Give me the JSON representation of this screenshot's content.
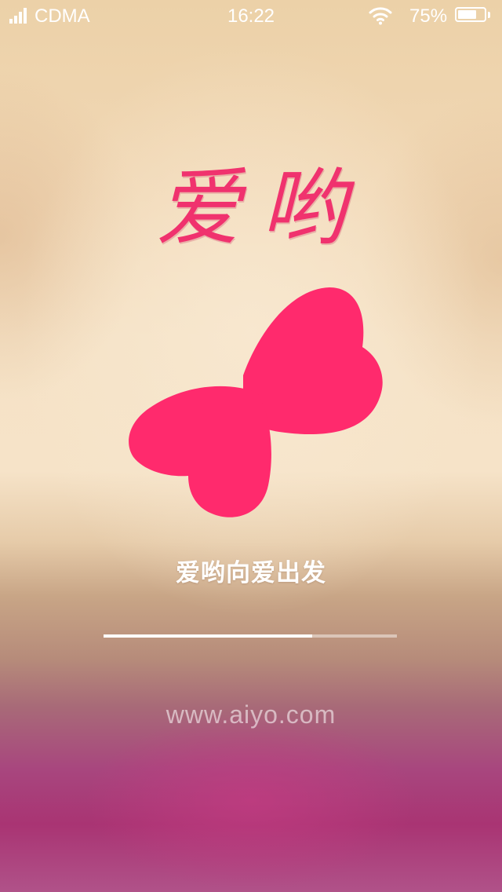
{
  "status_bar": {
    "carrier": "CDMA",
    "time": "16:22",
    "battery_percent_label": "75%",
    "battery_level": 0.75,
    "icons": [
      "signal-icon",
      "wifi-icon",
      "battery-icon"
    ]
  },
  "splash": {
    "brand_title": "爱哟",
    "tagline": "爱哟向爱出发",
    "progress": 0.71,
    "website": "www.aiyo.com"
  },
  "colors": {
    "brand_pink": "#ff2a6d",
    "title_pink": "#f0326e",
    "status_text": "#ffffff"
  }
}
